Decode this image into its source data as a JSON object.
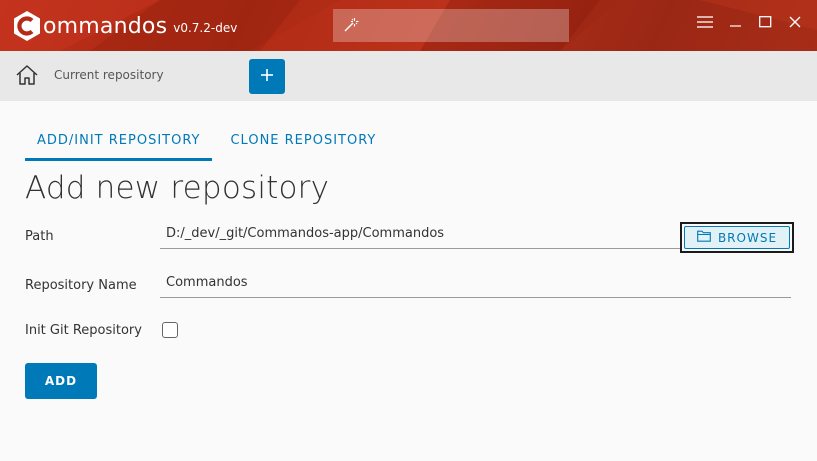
{
  "app": {
    "name": "ommandos",
    "version": "v0.7.2-dev",
    "brand_color": "#b52b17"
  },
  "search": {
    "placeholder": ""
  },
  "toolbar": {
    "current_repository": "Current repository",
    "add_icon": "plus-icon"
  },
  "tabs": [
    {
      "label": "ADD/INIT REPOSITORY",
      "active": true
    },
    {
      "label": "CLONE REPOSITORY",
      "active": false
    }
  ],
  "form": {
    "title": "Add new repository",
    "path_label": "Path",
    "path_value": "D:/_dev/_git/Commandos-app/Commandos",
    "browse_label": "BROWSE",
    "name_label": "Repository Name",
    "name_value": "Commandos",
    "init_label": "Init Git Repository",
    "init_checked": false,
    "submit_label": "ADD"
  },
  "colors": {
    "accent": "#0079b8"
  }
}
